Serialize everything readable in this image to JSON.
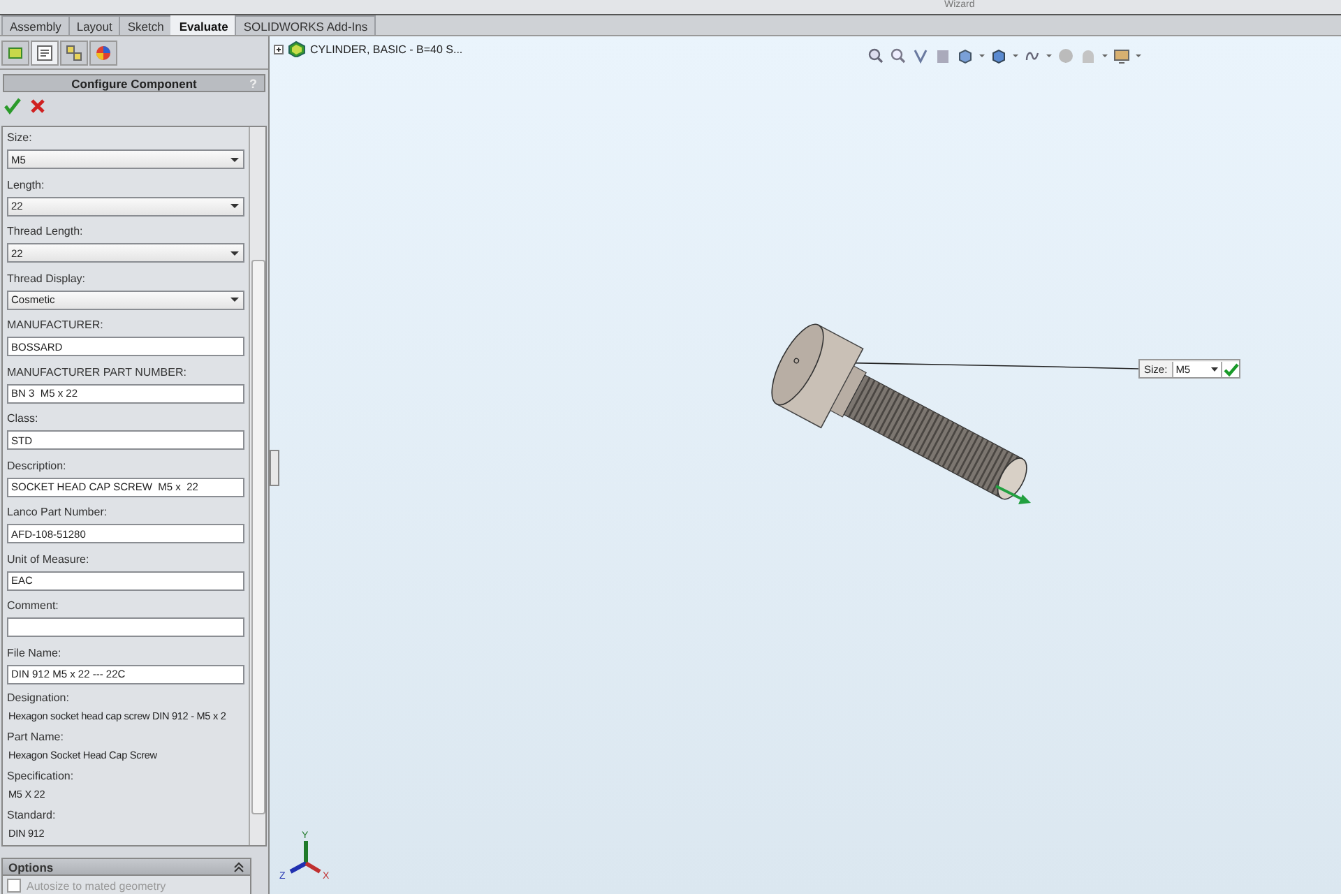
{
  "ribbon": {
    "group_label": "Wizard"
  },
  "tabs": [
    {
      "label": "Assembly",
      "selected": false
    },
    {
      "label": "Layout",
      "selected": false
    },
    {
      "label": "Sketch",
      "selected": false
    },
    {
      "label": "Evaluate",
      "selected": true
    },
    {
      "label": "SOLIDWORKS Add-Ins",
      "selected": false
    }
  ],
  "panel_tabs": [
    {
      "selected": false
    },
    {
      "selected": true
    },
    {
      "selected": false
    },
    {
      "selected": false
    }
  ],
  "property_manager": {
    "title": "Configure Component",
    "help": "?",
    "fields": [
      {
        "kind": "select",
        "label": "Size:",
        "value": "M5"
      },
      {
        "kind": "select",
        "label": "Length:",
        "value": "22"
      },
      {
        "kind": "select",
        "label": "Thread Length:",
        "value": "22"
      },
      {
        "kind": "select",
        "label": "Thread Display:",
        "value": "Cosmetic"
      },
      {
        "kind": "text",
        "label": "MANUFACTURER:",
        "value": "BOSSARD"
      },
      {
        "kind": "text",
        "label": "MANUFACTURER PART NUMBER:",
        "value": "BN 3  M5 x 22"
      },
      {
        "kind": "text",
        "label": "Class:",
        "value": "STD"
      },
      {
        "kind": "text",
        "label": "Description:",
        "value": "SOCKET HEAD CAP SCREW  M5 x  22"
      },
      {
        "kind": "text",
        "label": "Lanco Part Number:",
        "value": "AFD-108-51280"
      },
      {
        "kind": "text",
        "label": "Unit of Measure:",
        "value": "EAC"
      },
      {
        "kind": "text",
        "label": "Comment:"
      },
      {
        "kind": "text",
        "label": "File Name:",
        "value": "DIN 912 M5 x 22 --- 22C"
      },
      {
        "kind": "static",
        "label": "Designation:",
        "value": "Hexagon socket head cap screw DIN 912 - M5 x 2"
      },
      {
        "kind": "static",
        "label": "Part Name:",
        "value": "Hexagon Socket Head Cap Screw"
      },
      {
        "kind": "static",
        "label": "Specification:",
        "value": "M5 X 22"
      },
      {
        "kind": "static",
        "label": "Standard:",
        "value": "DIN 912"
      }
    ],
    "options": {
      "title": "Options",
      "items": [
        {
          "label": "Autosize to mated geometry",
          "checked": false
        }
      ]
    }
  },
  "viewport": {
    "tree_item": "CYLINDER, BASIC - B=40 S...",
    "callout": {
      "label": "Size:",
      "value": "M5"
    },
    "triad": {
      "x": "X",
      "y": "Y",
      "z": "Z"
    }
  }
}
